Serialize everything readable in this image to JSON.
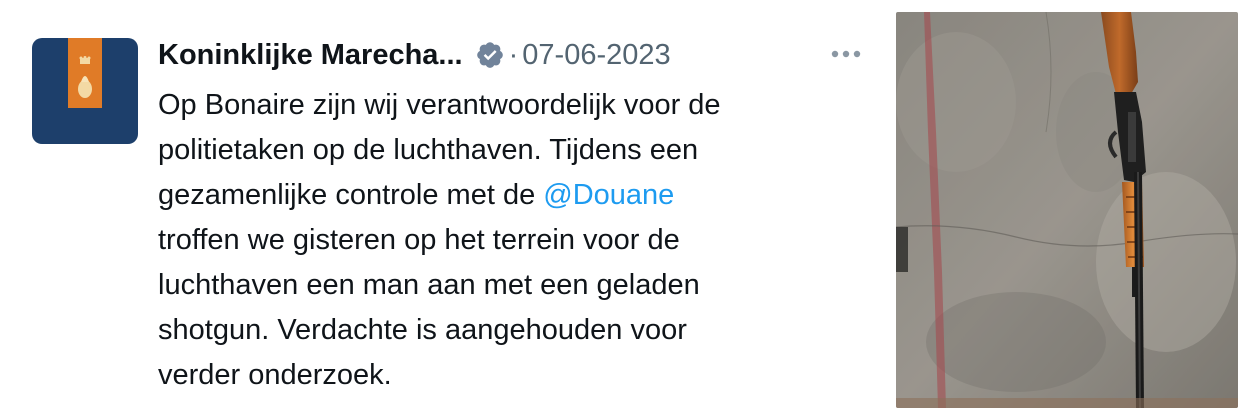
{
  "author": {
    "display_name": "Koninklijke Marecha...",
    "separator": "·",
    "date": "07-06-2023",
    "avatar_icon": "marechaussee-emblem-icon",
    "verified_icon": "verified-badge-icon",
    "verified_color": "#71839a"
  },
  "tweet": {
    "lines": [
      "Op Bonaire zijn wij verantwoordelijk voor de",
      "politietaken op de luchthaven. Tijdens een",
      "gezamenlijke controle met de ",
      "troffen we gisteren op het terrein voor de",
      "luchthaven een man aan met een geladen",
      "shotgun. Verdachte is aangehouden voor",
      "verder onderzoek."
    ],
    "mention": "@Douane",
    "mention_color": "#1d9bf0"
  },
  "menu": {
    "more_icon": "more-options-icon"
  },
  "media": {
    "subject": "photo-shotgun-on-concrete-floor"
  }
}
